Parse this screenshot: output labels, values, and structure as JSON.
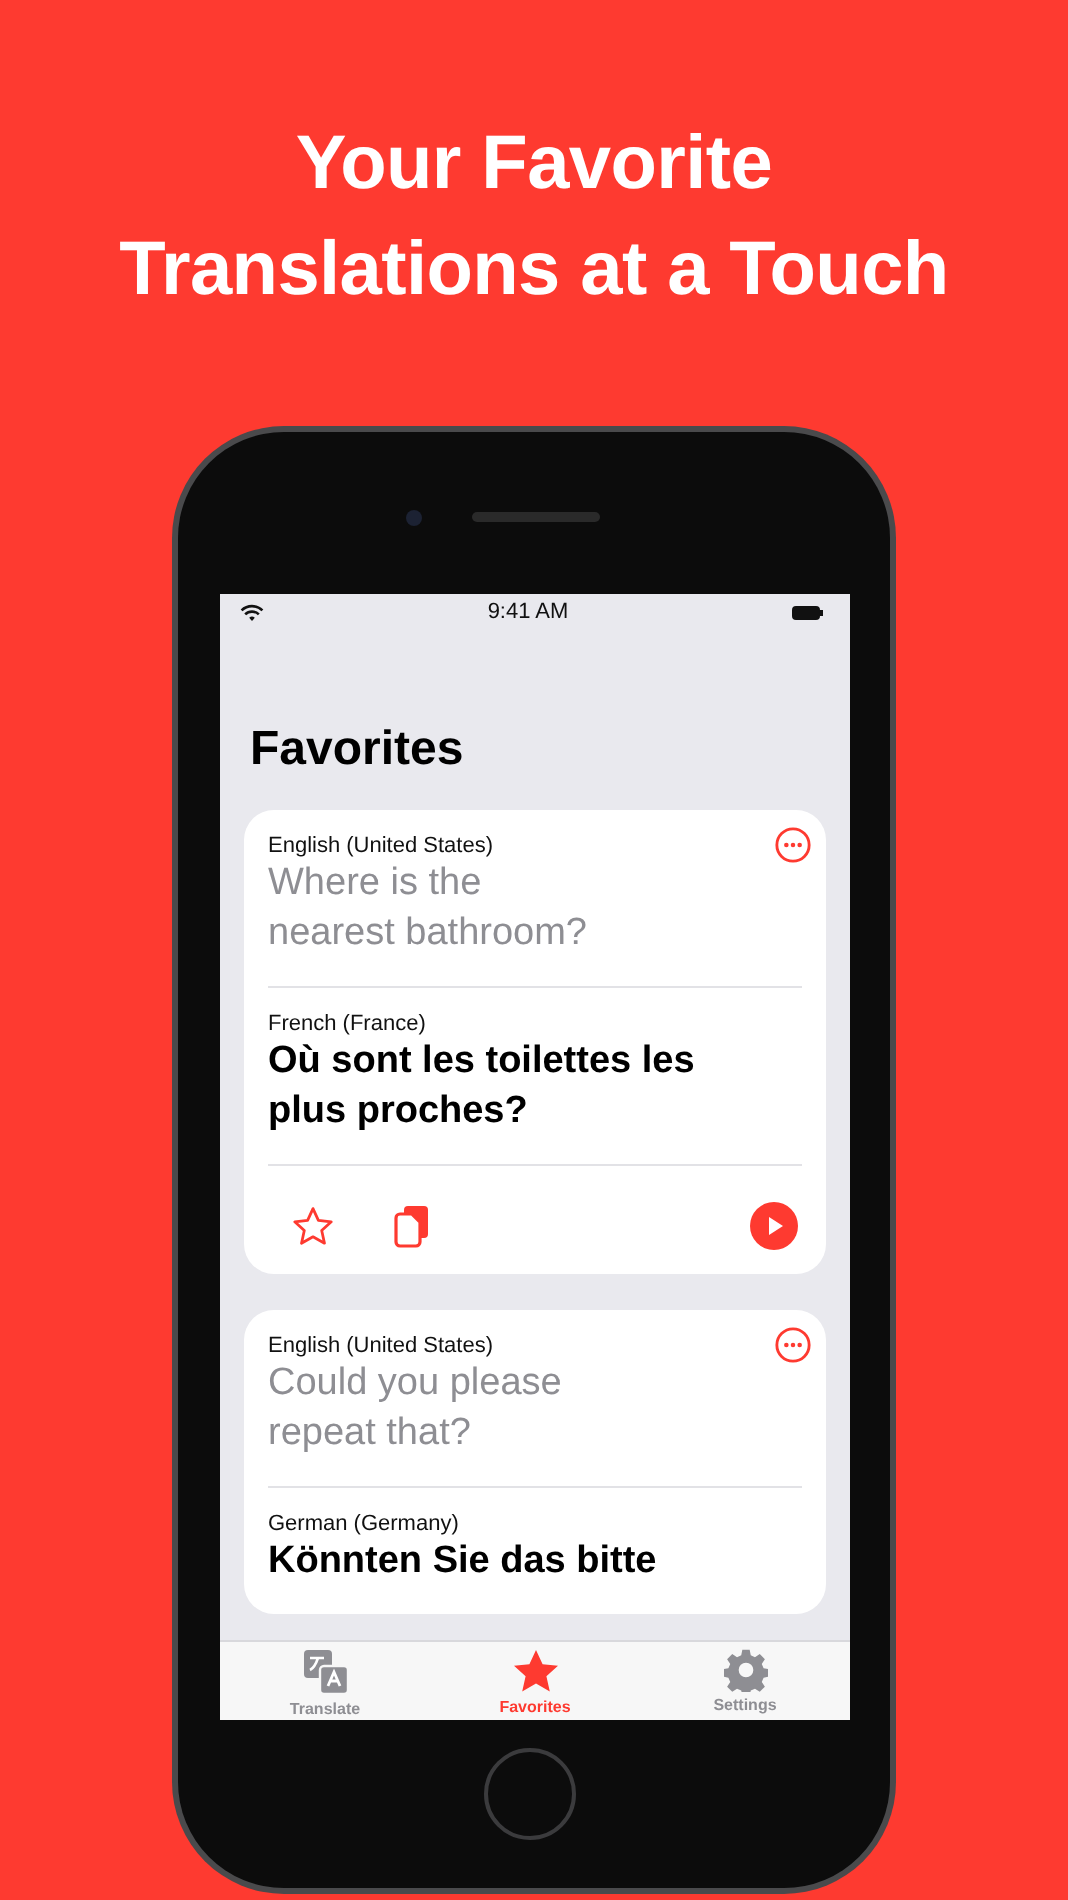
{
  "headline": [
    "Your Favorite",
    "Translations at a Touch"
  ],
  "status_bar": {
    "time": "9:41 AM"
  },
  "title": "Favorites",
  "cards": [
    {
      "source_language": "English (United States)",
      "source_text": "Where is the nearest bathroom?",
      "target_language": "French (France)",
      "target_text": "Où sont les toilettes les plus proches?",
      "actions_visible": true
    },
    {
      "source_language": "English (United States)",
      "source_text": "Could you please repeat that?",
      "target_language": "German (Germany)",
      "target_text": "Könnten Sie das bitte",
      "actions_visible": false
    }
  ],
  "tabs": [
    {
      "kind": "translate",
      "label": "Translate",
      "selected": false
    },
    {
      "kind": "favorites",
      "label": "Favorites",
      "selected": true
    },
    {
      "kind": "settings",
      "label": "Settings",
      "selected": false
    }
  ]
}
